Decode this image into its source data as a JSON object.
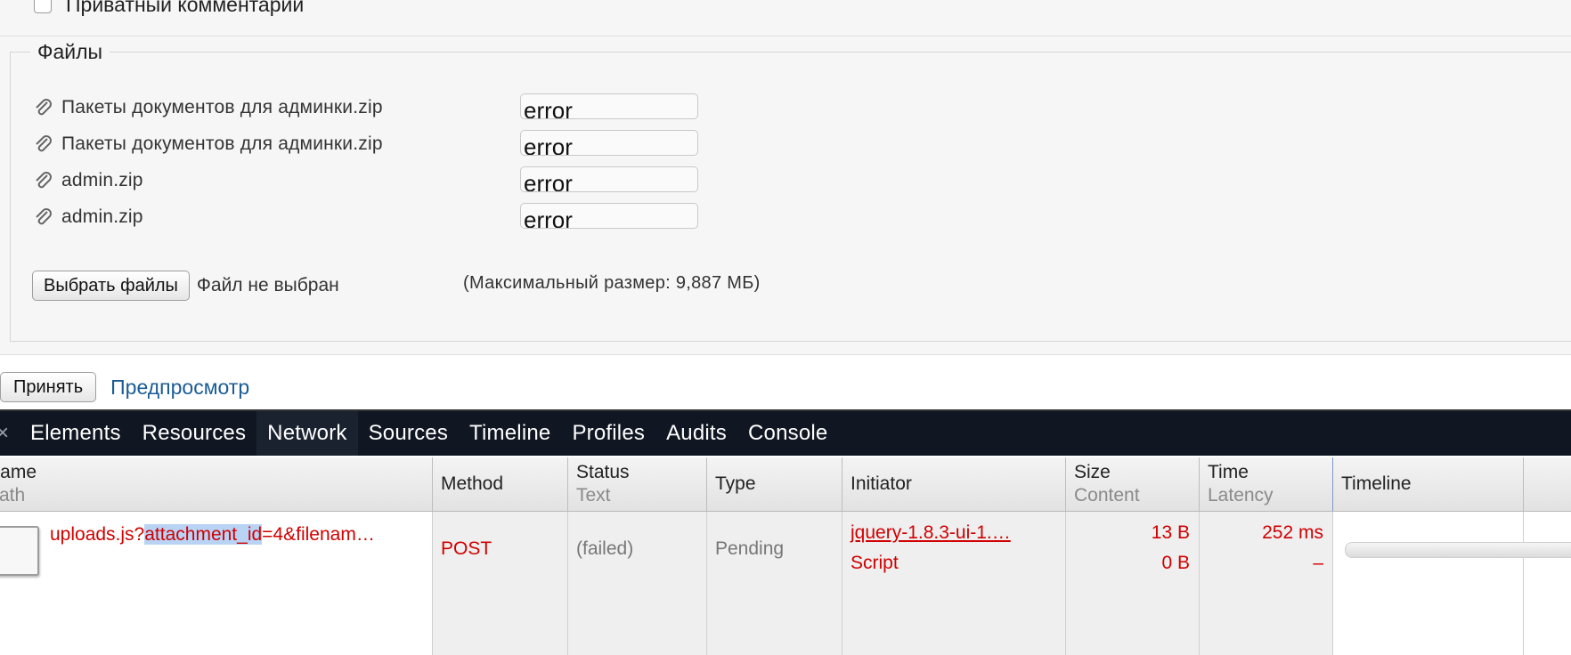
{
  "form": {
    "private_comment_label": "Приватный комментарий",
    "files_legend": "Файлы",
    "files": [
      {
        "name": "Пакеты документов для админки.zip",
        "status": "error"
      },
      {
        "name": "Пакеты документов для админки.zip",
        "status": "error"
      },
      {
        "name": "admin.zip",
        "status": "error"
      },
      {
        "name": "admin.zip",
        "status": "error"
      }
    ],
    "choose_files_label": "Выбрать файлы",
    "no_file_label": "Файл не выбран",
    "max_size_label": "(Максимальный размер: 9,887 МБ)",
    "submit_label": "Принять",
    "preview_label": "Предпросмотр"
  },
  "devtools": {
    "close_glyph": "×",
    "tabs": [
      "Elements",
      "Resources",
      "Network",
      "Sources",
      "Timeline",
      "Profiles",
      "Audits",
      "Console"
    ],
    "active_tab": "Network",
    "columns": [
      {
        "main": "Name",
        "sub": "Path"
      },
      {
        "main": "Method",
        "sub": ""
      },
      {
        "main": "Status",
        "sub": "Text"
      },
      {
        "main": "Type",
        "sub": ""
      },
      {
        "main": "Initiator",
        "sub": ""
      },
      {
        "main": "Size",
        "sub": "Content"
      },
      {
        "main": "Time",
        "sub": "Latency"
      },
      {
        "main": "Timeline",
        "sub": ""
      }
    ],
    "request": {
      "url_prefix": "uploads.js?",
      "url_highlight": "attachment_id",
      "url_suffix": "=4&filenam…",
      "method": "POST",
      "status": "(failed)",
      "type": "Pending",
      "initiator": "jquery-1.8.3-ui-1.…",
      "initiator_type": "Script",
      "size": "13 B",
      "content": "0 B",
      "time": "252 ms",
      "latency": "–"
    }
  },
  "colors": {
    "error_red": "#d10000",
    "toolbar_bg": "#101722",
    "link_blue": "#1b5c96"
  }
}
